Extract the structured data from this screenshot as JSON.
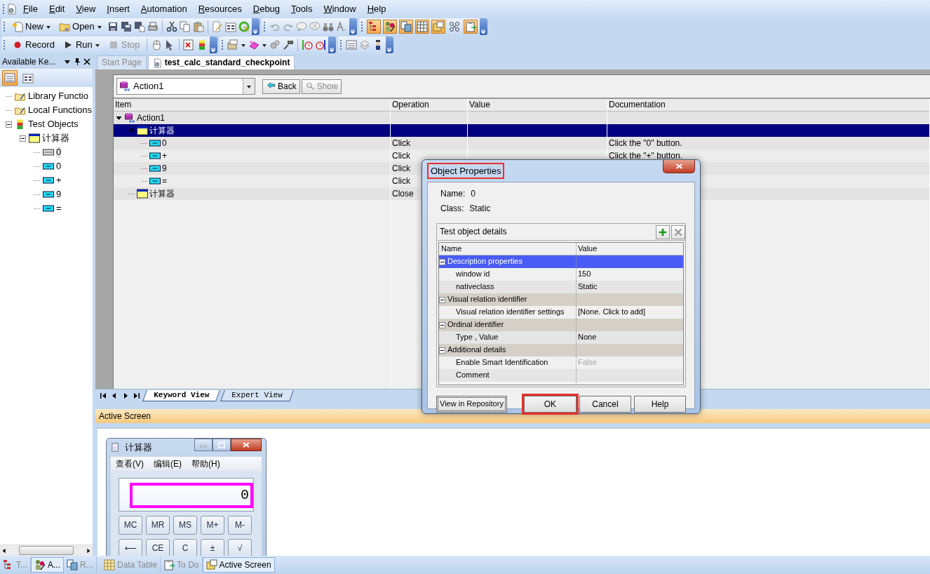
{
  "menu_bar": [
    "File",
    "Edit",
    "View",
    "Insert",
    "Automation",
    "Resources",
    "Debug",
    "Tools",
    "Window",
    "Help"
  ],
  "toolbar_buttons": [
    {
      "label": "New",
      "dropdown": true,
      "disabled": false
    },
    {
      "label": "Open",
      "dropdown": true,
      "disabled": false
    },
    {
      "label": "Record",
      "dropdown": false,
      "disabled": false
    },
    {
      "label": "Run",
      "dropdown": true,
      "disabled": false
    },
    {
      "label": "Stop",
      "dropdown": false,
      "disabled": true
    }
  ],
  "pane_toggles": [
    {
      "selected": true
    },
    {
      "selected": true
    },
    {
      "selected": true
    },
    {
      "selected": true
    },
    {
      "selected": true
    },
    {
      "selected": false
    },
    {
      "selected": true
    }
  ],
  "left_panel": {
    "title": "Available Ke...",
    "view_buttons": [
      {
        "selected": true
      },
      {
        "selected": false
      }
    ],
    "tree": [
      {
        "label": "Library Functio",
        "kind": "library",
        "selected": false
      },
      {
        "label": "Local Functions",
        "kind": "library",
        "selected": false
      },
      {
        "label": "Test Objects",
        "kind": "objects",
        "expanded": true,
        "selected": false,
        "children": [
          {
            "label": "计算器",
            "kind": "window",
            "expanded": true,
            "selected": false,
            "children": [
              {
                "label": "0",
                "kind": "static",
                "selected": true
              },
              {
                "label": "0",
                "kind": "button",
                "selected": false
              },
              {
                "label": "+",
                "kind": "button",
                "selected": false
              },
              {
                "label": "9",
                "kind": "button",
                "selected": false
              },
              {
                "label": "=",
                "kind": "button",
                "selected": false
              }
            ]
          }
        ]
      }
    ],
    "tabs": [
      {
        "label": "T...",
        "selected": false
      },
      {
        "label": "A...",
        "selected": true
      },
      {
        "label": "R...",
        "selected": false
      }
    ]
  },
  "doc_tabs": [
    {
      "label": "Start Page",
      "selected": false
    },
    {
      "label": "test_calc_standard_checkpoint",
      "selected": true
    }
  ],
  "action_select": {
    "value": "Action1"
  },
  "nav_buttons": [
    {
      "label": "Back",
      "disabled": false
    },
    {
      "label": "Show",
      "disabled": true
    }
  ],
  "keyword_grid": {
    "columns": [
      "Item",
      "Operation",
      "Value",
      "Documentation"
    ],
    "rows": [
      {
        "item": "Action1",
        "kind": "action",
        "expanded": true,
        "selected": false,
        "children": [
          {
            "item": "计算器",
            "kind": "window",
            "expanded": true,
            "selected": true,
            "children": [
              {
                "item": "0",
                "kind": "button",
                "selected": false,
                "operation": "Click",
                "documentation": "Click the \"0\" button."
              },
              {
                "item": "+",
                "kind": "button",
                "selected": false,
                "operation": "Click",
                "documentation": "Click the \"+\" button."
              },
              {
                "item": "9",
                "kind": "button",
                "selected": false,
                "operation": "Click"
              },
              {
                "item": "=",
                "kind": "button",
                "selected": false,
                "operation": "Click"
              }
            ]
          },
          {
            "item": "计算器",
            "kind": "window",
            "selected": false,
            "operation": "Close"
          }
        ]
      }
    ]
  },
  "sheet_tabs": [
    {
      "label": "Keyword View",
      "selected": true
    },
    {
      "label": "Expert View",
      "selected": false
    }
  ],
  "active_screen": {
    "title": "Active Screen",
    "calculator": {
      "title": "计算器",
      "menus": [
        "查看(V)",
        "编辑(E)",
        "帮助(H)"
      ],
      "display": "0",
      "display_highlighted": true,
      "keys": [
        [
          "MC",
          "MR",
          "MS",
          "M+",
          "M-"
        ],
        [
          "⟵",
          "CE",
          "C",
          "±",
          "√"
        ]
      ]
    }
  },
  "bottom_tabs": [
    {
      "label": "Data Table",
      "selected": false
    },
    {
      "label": "To Do",
      "selected": false
    },
    {
      "label": "Active Screen",
      "selected": true
    }
  ],
  "dialog": {
    "title": "Object Properties",
    "title_highlighted": true,
    "name_label": "Name:",
    "name": "0",
    "class_label": "Class:",
    "class": "Static",
    "details_title": "Test object details",
    "columns": [
      "Name",
      "Value"
    ],
    "groups": [
      {
        "label": "Description properties",
        "selected": true,
        "expanded": true,
        "properties": [
          {
            "name": "window id",
            "value": "150",
            "disabled": false
          },
          {
            "name": "nativeclass",
            "value": "Static",
            "disabled": false
          }
        ]
      },
      {
        "label": "Visual relation identifier",
        "selected": false,
        "expanded": true,
        "properties": [
          {
            "name": "Visual relation identifier settings",
            "value": "[None. Click to add]",
            "disabled": false
          }
        ]
      },
      {
        "label": "Ordinal identifier",
        "selected": false,
        "expanded": true,
        "properties": [
          {
            "name": "Type , Value",
            "value": "None",
            "disabled": false
          }
        ]
      },
      {
        "label": "Additional details",
        "selected": false,
        "expanded": true,
        "properties": [
          {
            "name": "Enable Smart Identification",
            "value": "False",
            "disabled": true
          },
          {
            "name": "Comment",
            "disabled": false
          }
        ]
      }
    ],
    "buttons": [
      {
        "label": "View in Repository",
        "highlighted": false
      },
      {
        "label": "OK",
        "highlighted": true
      },
      {
        "label": "Cancel",
        "highlighted": false
      },
      {
        "label": "Help",
        "highlighted": false
      }
    ]
  }
}
